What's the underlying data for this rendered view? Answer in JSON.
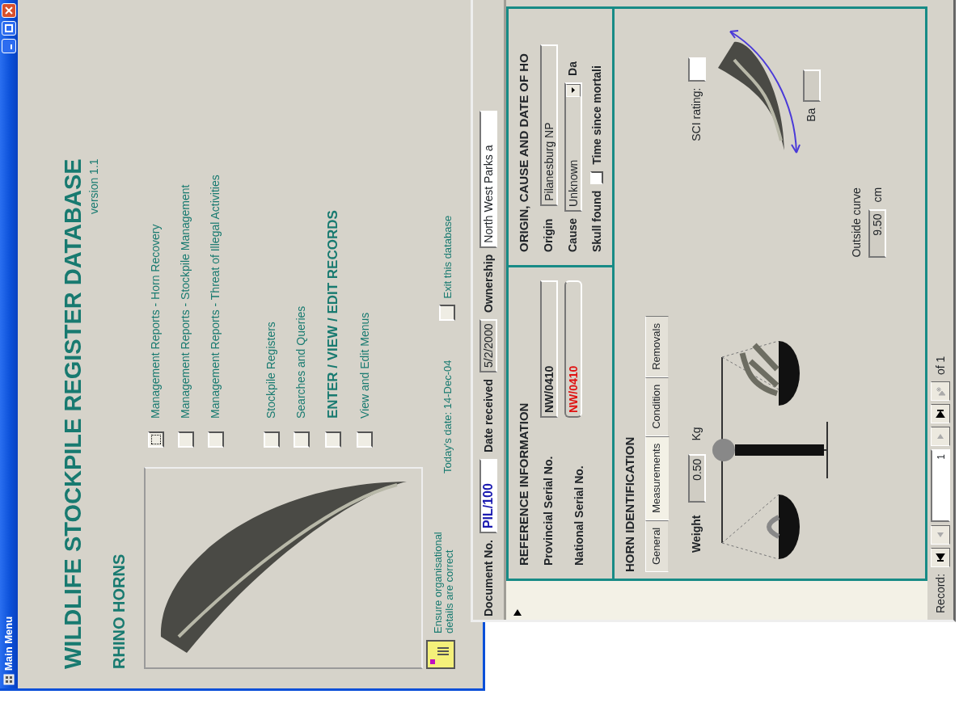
{
  "main_menu": {
    "title": "Main Menu",
    "heading": "WILDLIFE STOCKPILE REGISTER DATABASE",
    "version": "version 1.1",
    "subheading": "RHINO HORNS",
    "menu_groups": [
      [
        {
          "label": "Management Reports - Horn Recovery",
          "kind": "normal",
          "checked": false,
          "focused": true
        },
        {
          "label": "Management Reports - Stockpile Management",
          "kind": "normal",
          "checked": false,
          "focused": false
        },
        {
          "label": "Management Reports - Threat of Illegal Activities",
          "kind": "normal",
          "checked": false,
          "focused": false
        }
      ],
      [
        {
          "label": "Stockpile Registers",
          "kind": "normal",
          "checked": false,
          "focused": false
        },
        {
          "label": "Searches and Queries",
          "kind": "normal",
          "checked": false,
          "focused": false
        },
        {
          "label": "ENTER / VIEW / EDIT RECORDS",
          "kind": "primary",
          "checked": false,
          "focused": false
        },
        {
          "label": "View and Edit Menus",
          "kind": "normal",
          "checked": false,
          "focused": false
        }
      ]
    ],
    "note": "Ensure organisational details are correct",
    "today": "Today's date:  14-Dec-04",
    "exit": {
      "label": "Exit this database",
      "checked": false
    }
  },
  "record_form": {
    "header": [
      {
        "label": "Document No.",
        "value": "PIL/100",
        "kind": "key"
      },
      {
        "label": "Date received",
        "value": "5/2/2000",
        "kind": "date"
      },
      {
        "label": "Ownership",
        "value": "North West Parks a",
        "kind": "text"
      }
    ],
    "reference": {
      "title": "REFERENCE INFORMATION",
      "fields": [
        {
          "label": "Provincial Serial No.",
          "value": "NW/0410",
          "alert": false
        },
        {
          "label": "National Serial No.",
          "value": "NW/0410",
          "alert": true
        }
      ]
    },
    "origin": {
      "title": "ORIGIN, CAUSE AND DATE OF HO",
      "origin_label": "Origin",
      "origin_value": "Pilanesburg NP",
      "cause_label": "Cause",
      "cause_value": "Unknown",
      "date_label": "Da",
      "skull_label": "Skull found",
      "skull_checked": false,
      "time_label": "Time since mortali"
    },
    "horn": {
      "title": "HORN IDENTIFICATION",
      "tabs": [
        {
          "label": "General",
          "selected": false
        },
        {
          "label": "Measurements",
          "selected": true
        },
        {
          "label": "Condition",
          "selected": false
        },
        {
          "label": "Removals",
          "selected": false
        }
      ],
      "weight": {
        "label": "Weight",
        "value": "0.50",
        "unit": "Kg"
      },
      "outside_curve": {
        "label": "Outside curve",
        "value": "9.50",
        "unit": "cm"
      },
      "sci_label": "SCI rating:",
      "base_label": "Ba"
    },
    "navigator": {
      "label": "Record:",
      "current": "1",
      "total": "of 1",
      "buttons": [
        {
          "kind": "first",
          "disabled": false
        },
        {
          "kind": "prev",
          "disabled": true
        },
        {
          "kind": "next",
          "disabled": true
        },
        {
          "kind": "last",
          "disabled": false
        },
        {
          "kind": "new",
          "disabled": true
        }
      ]
    }
  }
}
